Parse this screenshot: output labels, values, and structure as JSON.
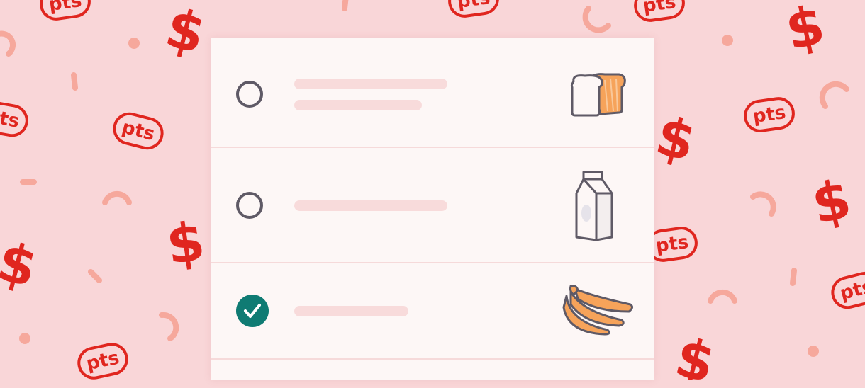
{
  "background": {
    "color": "#f9d6d8",
    "symbol_color": "#e0261f",
    "confetti_color": "#f6a89c",
    "badge_text": "pts",
    "dollar_symbol": "$"
  },
  "list": {
    "background": "#fdf7f6",
    "items": [
      {
        "checked": false,
        "icon": "bread-icon"
      },
      {
        "checked": false,
        "icon": "milk-carton-icon"
      },
      {
        "checked": true,
        "icon": "banana-bunch-icon"
      },
      {
        "checked": false,
        "icon": ""
      }
    ]
  },
  "colors": {
    "radio_border": "#5f5a66",
    "checked_fill": "#0f7b73",
    "placeholder_bar": "#f8dbdb",
    "icon_orange": "#f6a35a",
    "icon_outline": "#5f5a66"
  }
}
